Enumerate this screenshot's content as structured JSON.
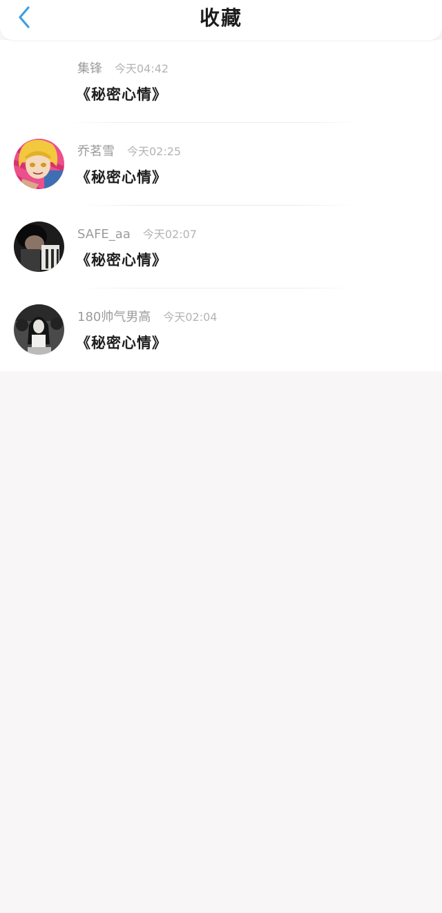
{
  "header": {
    "title": "收藏",
    "back_icon": "chevron-left-icon",
    "accent_color": "#3b9fe3"
  },
  "items": [
    {
      "user": "集锋",
      "time": "今天04:42",
      "topic": "《秘密心情》",
      "avatar": "none"
    },
    {
      "user": "乔茗雪",
      "time": "今天02:25",
      "topic": "《秘密心情》",
      "avatar": "anime-avatar"
    },
    {
      "user": "SAFE_aa",
      "time": "今天02:07",
      "topic": "《秘密心情》",
      "avatar": "dark-photo-avatar"
    },
    {
      "user": "180帅气男高",
      "time": "今天02:04",
      "topic": "《秘密心情》",
      "avatar": "bw-photo-avatar"
    }
  ]
}
